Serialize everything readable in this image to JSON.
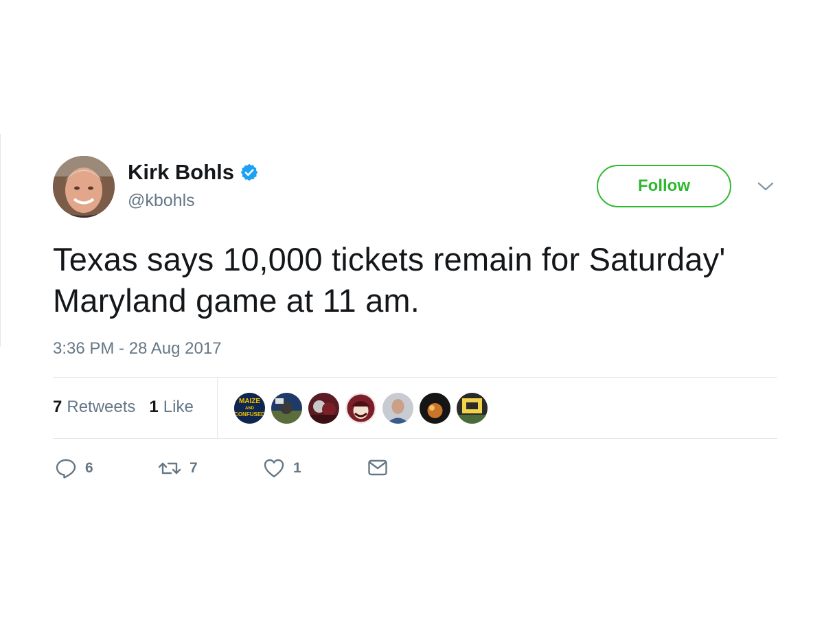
{
  "user": {
    "display_name": "Kirk Bohls",
    "handle": "@kbohls",
    "verified": true
  },
  "follow_label": "Follow",
  "tweet_text": "Texas says 10,000 tickets remain for Saturday' Maryland game at 11 am.",
  "timestamp": "3:36 PM - 28 Aug 2017",
  "stats": {
    "retweets_count": "7",
    "retweets_label": "Retweets",
    "likes_count": "1",
    "likes_label": "Like"
  },
  "actions": {
    "reply_count": "6",
    "retweet_count": "7",
    "like_count": "1"
  },
  "liker_avatars": [
    {
      "logo_text": "MAIZE AND CONFUSED"
    },
    {},
    {},
    {},
    {},
    {},
    {}
  ],
  "colors": {
    "follow_green": "#2eb82e",
    "verified_blue": "#1da1f2",
    "secondary_text": "#657786",
    "divider": "#e1e8ed"
  },
  "icons": [
    "verified-badge-icon",
    "chevron-down-icon",
    "reply-icon",
    "retweet-icon",
    "heart-icon",
    "message-icon"
  ]
}
